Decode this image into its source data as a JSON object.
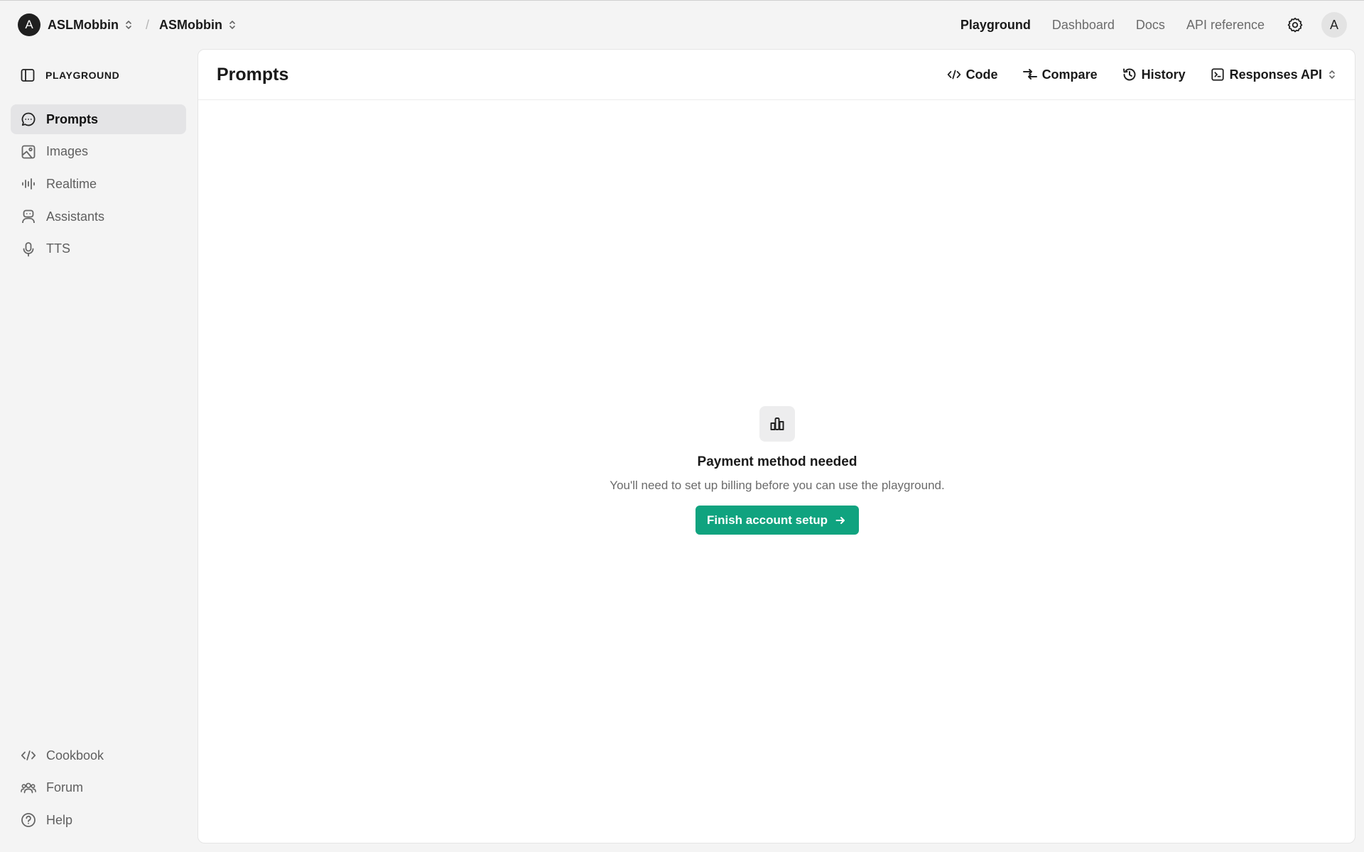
{
  "topbar": {
    "org": {
      "avatar_letter": "A",
      "name": "ASLMobbin"
    },
    "separator": "/",
    "project": {
      "name": "ASMobbin"
    },
    "nav": [
      {
        "label": "Playground",
        "active": true
      },
      {
        "label": "Dashboard",
        "active": false
      },
      {
        "label": "Docs",
        "active": false
      },
      {
        "label": "API reference",
        "active": false
      }
    ],
    "settings_icon": "gear-icon",
    "user_avatar_letter": "A"
  },
  "sidebar": {
    "header": {
      "label": "PLAYGROUND",
      "icon": "sidebar-toggle-icon"
    },
    "items": [
      {
        "label": "Prompts",
        "icon": "chat-bubble-icon",
        "active": true
      },
      {
        "label": "Images",
        "icon": "image-icon",
        "active": false
      },
      {
        "label": "Realtime",
        "icon": "audio-wave-icon",
        "active": false
      },
      {
        "label": "Assistants",
        "icon": "robot-icon",
        "active": false
      },
      {
        "label": "TTS",
        "icon": "microphone-icon",
        "active": false
      }
    ],
    "bottom_items": [
      {
        "label": "Cookbook",
        "icon": "code-icon"
      },
      {
        "label": "Forum",
        "icon": "users-icon"
      },
      {
        "label": "Help",
        "icon": "help-circle-icon"
      }
    ]
  },
  "main": {
    "title": "Prompts",
    "actions": [
      {
        "label": "Code",
        "icon": "code-icon"
      },
      {
        "label": "Compare",
        "icon": "compare-icon"
      },
      {
        "label": "History",
        "icon": "history-icon"
      },
      {
        "label": "Responses API",
        "icon": "terminal-icon"
      }
    ],
    "empty_state": {
      "icon": "bar-chart-icon",
      "title": "Payment method needed",
      "subtitle": "You'll need to set up billing before you can use the playground.",
      "button_label": "Finish account setup"
    }
  },
  "colors": {
    "accent": "#10a37f",
    "background": "#f4f4f4",
    "active_item_bg": "#e4e4e6"
  }
}
